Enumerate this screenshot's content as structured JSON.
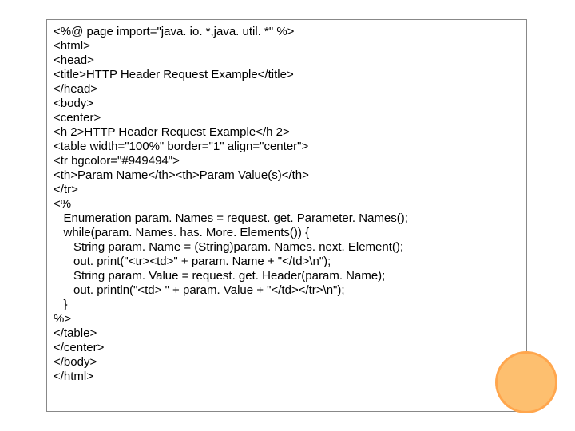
{
  "code": {
    "lines": [
      "<%@ page import=\"java. io. *,java. util. *\" %>",
      "<html>",
      "<head>",
      "<title>HTTP Header Request Example</title>",
      "</head>",
      "<body>",
      "<center>",
      "<h 2>HTTP Header Request Example</h 2>",
      "<table width=\"100%\" border=\"1\" align=\"center\">",
      "<tr bgcolor=\"#949494\">",
      "<th>Param Name</th><th>Param Value(s)</th>",
      "</tr>",
      "<%",
      "   Enumeration param. Names = request. get. Parameter. Names();",
      "",
      "   while(param. Names. has. More. Elements()) {",
      "      String param. Name = (String)param. Names. next. Element();",
      "      out. print(\"<tr><td>\" + param. Name + \"</td>\\n\");",
      "      String param. Value = request. get. Header(param. Name);",
      "      out. println(\"<td> \" + param. Value + \"</td></tr>\\n\");",
      "   }",
      "%>",
      "</table>",
      "</center>",
      "</body>",
      "</html>"
    ]
  }
}
